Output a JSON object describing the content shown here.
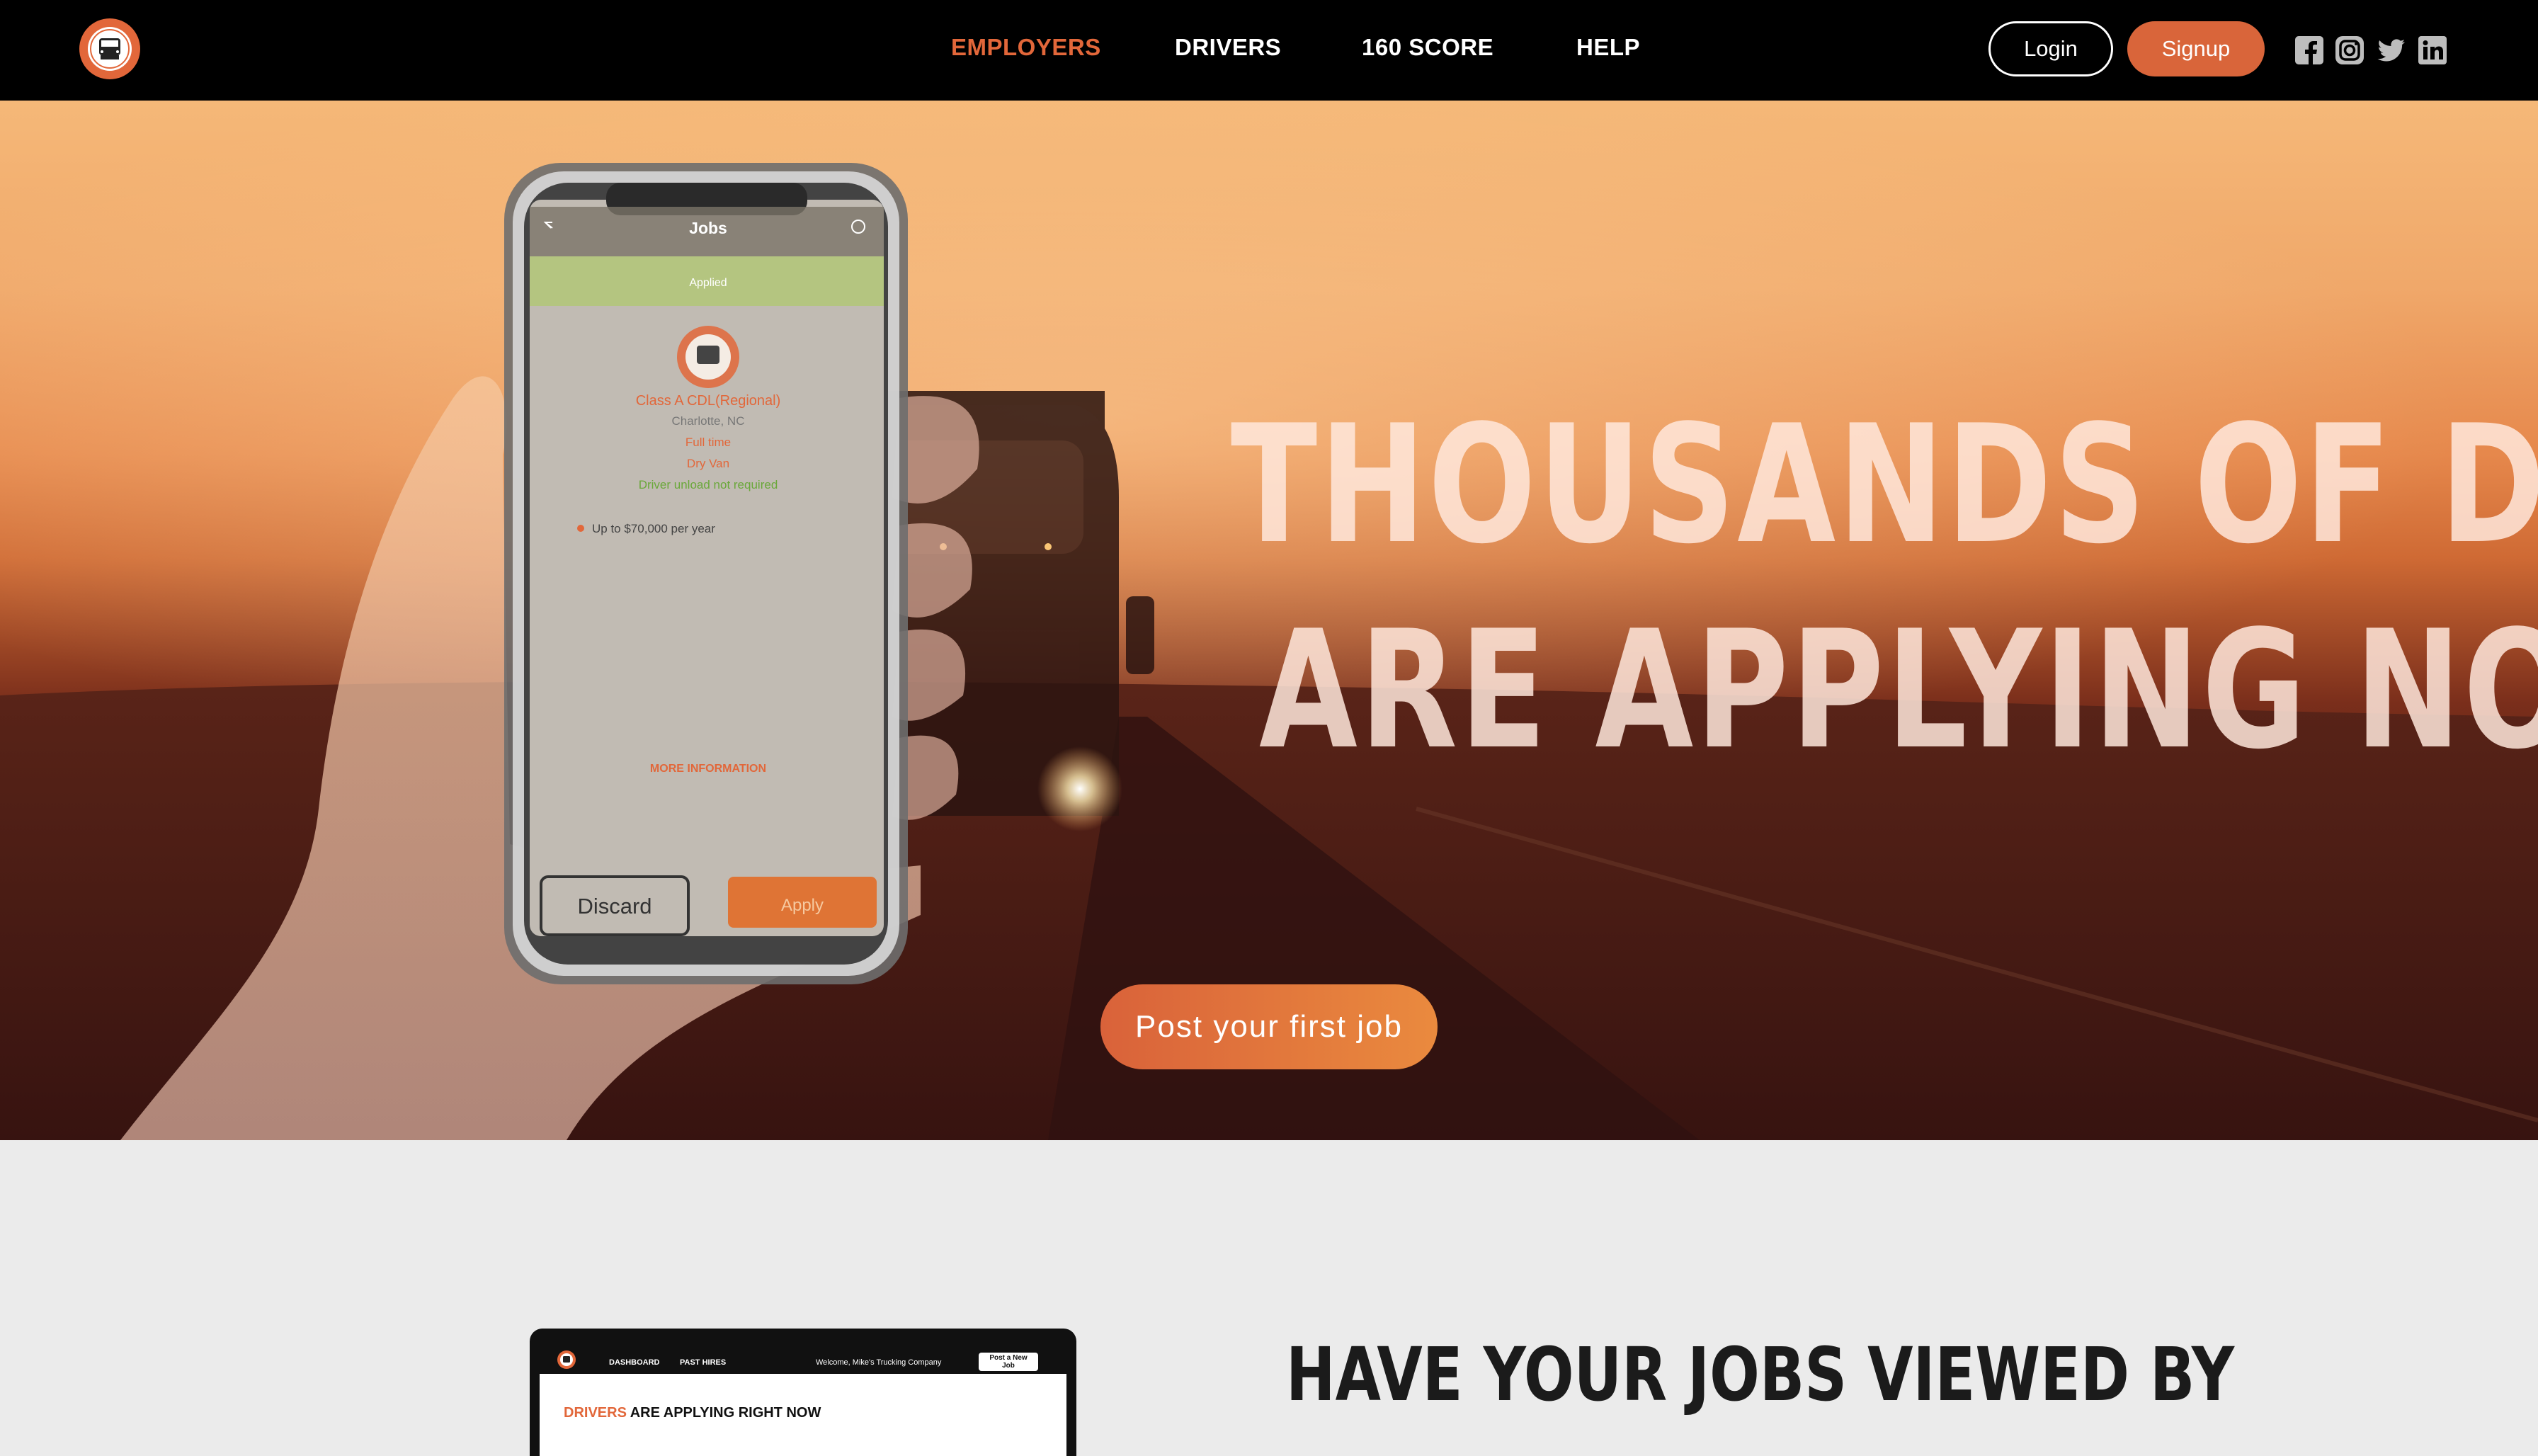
{
  "nav": {
    "links": [
      "EMPLOYERS",
      "DRIVERS",
      "160 SCORE",
      "HELP"
    ],
    "active": "EMPLOYERS",
    "login_label": "Login",
    "signup_label": "Signup",
    "social": [
      "facebook-icon",
      "instagram-icon",
      "twitter-icon",
      "linkedin-icon"
    ]
  },
  "hero": {
    "headline_line1": "THOUSANDS OF DRIVERS",
    "headline_line2": "ARE APPLYING NOW!",
    "cta_label": "Post your first job",
    "phone": {
      "title": "Jobs",
      "status": "Applied",
      "job_title": "Class A CDL(Regional)",
      "location": "Charlotte, NC",
      "detail_1": "Full time",
      "detail_2": "Dry Van",
      "detail_3": "Driver unload not required",
      "pay": "Up to $70,000 per year",
      "more_info": "MORE INFORMATION",
      "discard_label": "Discard",
      "apply_label": "Apply"
    }
  },
  "section2": {
    "title": "HAVE YOUR JOBS VIEWED BY",
    "laptop": {
      "tab_1": "DASHBOARD",
      "tab_2": "PAST HIRES",
      "welcome": "Welcome, Mike's Trucking Company",
      "post_button": "Post a New Job",
      "headline_highlight": "DRIVERS",
      "headline_rest": " ARE APPLYING RIGHT NOW"
    }
  },
  "colors": {
    "accent": "#e2673a",
    "nav_bg": "#000000",
    "section_bg": "#ebebeb",
    "apply_green_band": "#a9c56a"
  }
}
